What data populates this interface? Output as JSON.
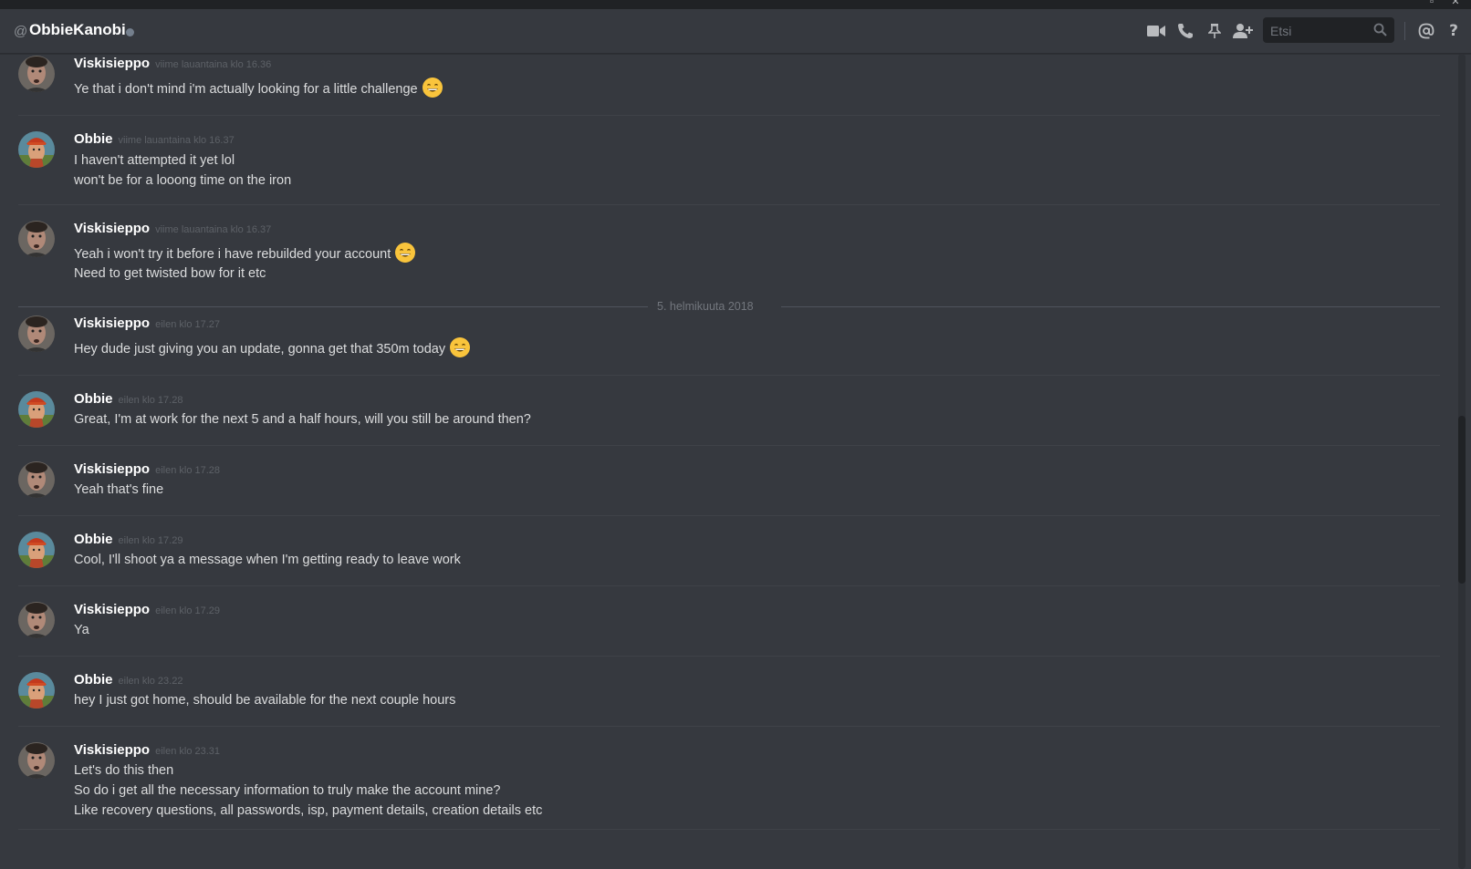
{
  "header": {
    "at_symbol": "@",
    "username": "ObbieKanobi",
    "status": "offline",
    "search_placeholder": "Etsi",
    "icons": [
      "video-icon",
      "phone-icon",
      "pin-icon",
      "add-friend-icon",
      "search-icon",
      "mention-icon",
      "help-icon"
    ]
  },
  "date_divider": "5. helmikuuta 2018",
  "messages": [
    {
      "author": "Viskisieppo",
      "timestamp": "viime lauantaina klo 16.36",
      "lines": [
        "Ye that i don't mind i'm actually looking for a little challenge"
      ],
      "emoji_on_line": [
        0
      ]
    },
    {
      "author": "Obbie",
      "timestamp": "viime lauantaina klo 16.37",
      "lines": [
        "I haven't attempted it yet lol",
        "won't be for a looong time on the iron"
      ]
    },
    {
      "author": "Viskisieppo",
      "timestamp": "viime lauantaina klo 16.37",
      "lines": [
        "Yeah i won't try it before i have rebuilded your account",
        "Need to get twisted bow for it etc"
      ],
      "emoji_on_line": [
        0
      ]
    },
    {
      "author": "Viskisieppo",
      "timestamp": "eilen klo 17.27",
      "lines": [
        "Hey dude just giving you an update, gonna get that 350m today"
      ],
      "emoji_on_line": [
        0
      ]
    },
    {
      "author": "Obbie",
      "timestamp": "eilen klo 17.28",
      "lines": [
        "Great, I'm at work for the next 5 and a half hours, will you still be around then?"
      ]
    },
    {
      "author": "Viskisieppo",
      "timestamp": "eilen klo 17.28",
      "lines": [
        "Yeah that's fine"
      ]
    },
    {
      "author": "Obbie",
      "timestamp": "eilen klo 17.29",
      "lines": [
        "Cool, I'll shoot ya a message when I'm getting ready to leave work"
      ]
    },
    {
      "author": "Viskisieppo",
      "timestamp": "eilen klo 17.29",
      "lines": [
        "Ya"
      ]
    },
    {
      "author": "Obbie",
      "timestamp": "eilen klo 23.22",
      "lines": [
        "hey I just got home, should be available for the next couple hours"
      ]
    },
    {
      "author": "Viskisieppo",
      "timestamp": "eilen klo 23.31",
      "lines": [
        "Let's do this then",
        "So do i get all the necessary information to truly make the account mine?",
        "Like recovery questions, all passwords, isp, payment details, creation details etc"
      ]
    }
  ],
  "colors": {
    "background": "#36393f",
    "title_bar": "#202225",
    "text": "#dcddde",
    "muted": "#72767d",
    "emoji": "#f9c43c"
  }
}
